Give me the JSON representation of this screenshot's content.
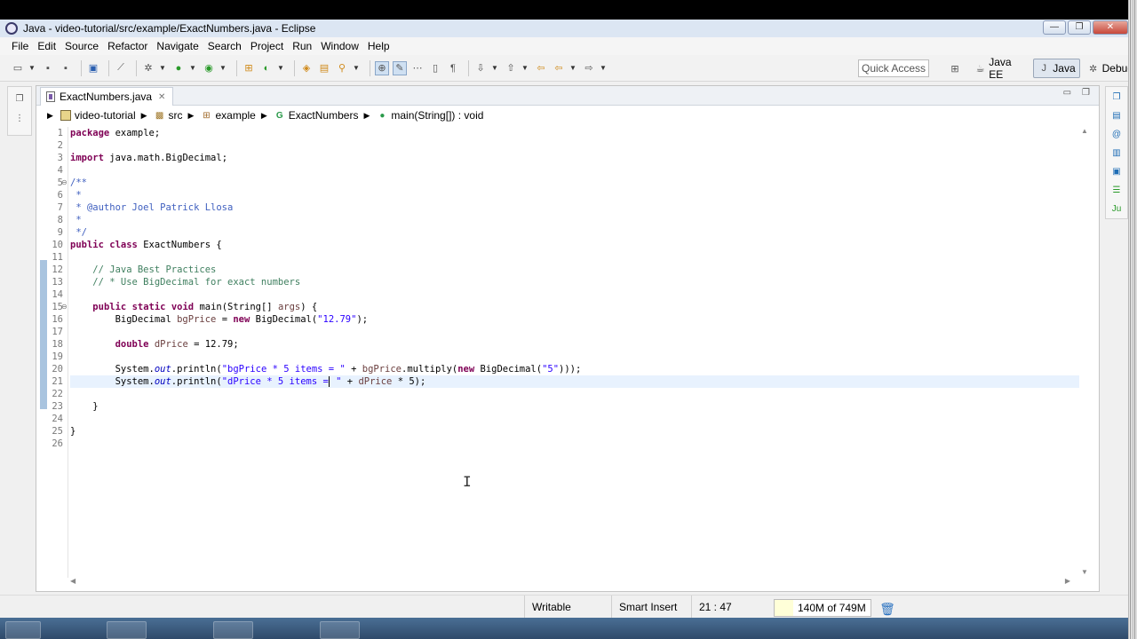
{
  "window": {
    "title": "Java - video-tutorial/src/example/ExactNumbers.java - Eclipse",
    "minimize_label": "—",
    "maximize_label": "❐",
    "close_label": "✕"
  },
  "menu": [
    "File",
    "Edit",
    "Source",
    "Refactor",
    "Navigate",
    "Search",
    "Project",
    "Run",
    "Window",
    "Help"
  ],
  "toolbar": {
    "quick_access": "Quick Access",
    "perspectives": [
      {
        "label": "",
        "icon": "open-perspective-icon",
        "active": false
      },
      {
        "label": "Java EE",
        "icon": "java-ee-perspective-icon",
        "active": false
      },
      {
        "label": "Java",
        "icon": "java-perspective-icon",
        "active": true
      },
      {
        "label": "Debug",
        "icon": "debug-perspective-icon",
        "active": false
      }
    ]
  },
  "editor": {
    "tab_label": "ExactNumbers.java",
    "breadcrumb": [
      {
        "label": "video-tutorial",
        "icon": "project-icon"
      },
      {
        "label": "src",
        "icon": "source-folder-icon"
      },
      {
        "label": "example",
        "icon": "package-icon"
      },
      {
        "label": "ExactNumbers",
        "icon": "class-icon"
      },
      {
        "label": "main(String[]) : void",
        "icon": "method-icon"
      }
    ],
    "line_numbers": [
      "1",
      "2",
      "3",
      "4",
      "5",
      "6",
      "7",
      "8",
      "9",
      "10",
      "11",
      "12",
      "13",
      "14",
      "15",
      "16",
      "17",
      "18",
      "19",
      "20",
      "21",
      "22",
      "23",
      "24",
      "25",
      "26"
    ],
    "code_lines": [
      "package example;",
      "",
      "import java.math.BigDecimal;",
      "",
      "/**",
      " * ",
      " * @author Joel Patrick Llosa",
      " *",
      " */",
      "public class ExactNumbers {",
      "",
      "    // Java Best Practices",
      "    // * Use BigDecimal for exact numbers",
      "",
      "    public static void main(String[] args) {",
      "        BigDecimal bgPrice = new BigDecimal(\"12.79\");",
      "",
      "        double dPrice = 12.79;",
      "",
      "        System.out.println(\"bgPrice * 5 items = \" + bgPrice.multiply(new BigDecimal(\"5\")));",
      "        System.out.println(\"dPrice * 5 items = \" + dPrice * 5);",
      "",
      "    }",
      "",
      "}",
      ""
    ],
    "current_line": 21
  },
  "status": {
    "writable": "Writable",
    "insert_mode": "Smart Insert",
    "position": "21 : 47",
    "heap": "140M of 749M",
    "heap_fraction": 0.19
  },
  "colors": {
    "keyword": "#7f0055",
    "comment": "#3f7f5f",
    "javadoc": "#3f5fbf",
    "string": "#2a00ff",
    "current_line": "#e8f2fe"
  }
}
